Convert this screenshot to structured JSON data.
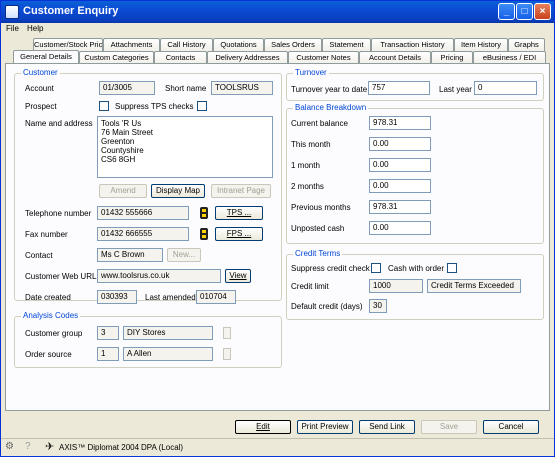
{
  "window": {
    "title": "Customer Enquiry"
  },
  "menu": {
    "file": "File",
    "help": "Help"
  },
  "tabs_row1": [
    "Customer/Stock Prices",
    "Attachments",
    "Call History",
    "Quotations",
    "Sales Orders",
    "Statement",
    "Transaction History",
    "Item History",
    "Graphs"
  ],
  "tabs_row2": [
    "General Details",
    "Custom Categories",
    "Contacts",
    "Delivery Addresses",
    "Customer Notes",
    "Account Details",
    "Pricing",
    "eBusiness / EDI"
  ],
  "customer": {
    "section": "Customer",
    "account_label": "Account",
    "account": "01/3005",
    "short_name_label": "Short name",
    "short_name": "TOOLSRUS",
    "prospect_label": "Prospect",
    "suppress_tps_label": "Suppress TPS checks",
    "name_address_label": "Name and address",
    "address_lines": [
      "Tools 'R Us",
      "76 Main Street",
      "Greenton",
      "Countyshire",
      "CS6 8GH"
    ],
    "amend_button": "Amend",
    "display_map_button": "Display Map",
    "intranet_button": "Intranet Page",
    "telephone_label": "Telephone number",
    "telephone": "01432 555666",
    "tps_button": "TPS ...",
    "fax_label": "Fax number",
    "fax": "01432 666555",
    "fps_button": "FPS ...",
    "contact_label": "Contact",
    "contact": "Ms C Brown",
    "new_button": "New...",
    "web_label": "Customer Web URL",
    "web": "www.toolsrus.co.uk",
    "view_button": "View",
    "created_label": "Date created",
    "created": "030393",
    "amended_label": "Last amended",
    "amended": "010704"
  },
  "analysis": {
    "section": "Analysis Codes",
    "group_label": "Customer group",
    "group_code": "3",
    "group_name": "DIY Stores",
    "source_label": "Order source",
    "source_code": "1",
    "source_name": "A Allen"
  },
  "turnover": {
    "section": "Turnover",
    "ytd_label": "Turnover year to date",
    "ytd": "757",
    "last_year_label": "Last year",
    "last_year": "0"
  },
  "balance": {
    "section": "Balance Breakdown",
    "rows": [
      {
        "label": "Current balance",
        "value": "978.31"
      },
      {
        "label": "This month",
        "value": "0.00"
      },
      {
        "label": "1 month",
        "value": "0.00"
      },
      {
        "label": "2 months",
        "value": "0.00"
      },
      {
        "label": "Previous months",
        "value": "978.31"
      },
      {
        "label": "Unposted cash",
        "value": "0.00"
      }
    ]
  },
  "credit": {
    "section": "Credit Terms",
    "suppress_label": "Suppress credit check",
    "cash_label": "Cash with order",
    "limit_label": "Credit limit",
    "limit": "1000",
    "limit_status": "Credit Terms Exceeded",
    "default_label": "Default credit (days)",
    "default": "30"
  },
  "actions": {
    "edit": "Edit",
    "print": "Print Preview",
    "send": "Send Link",
    "save": "Save",
    "cancel": "Cancel"
  },
  "statusbar": {
    "product": "AXIS™ Diplomat 2004",
    "db": "DPA (Local)"
  }
}
